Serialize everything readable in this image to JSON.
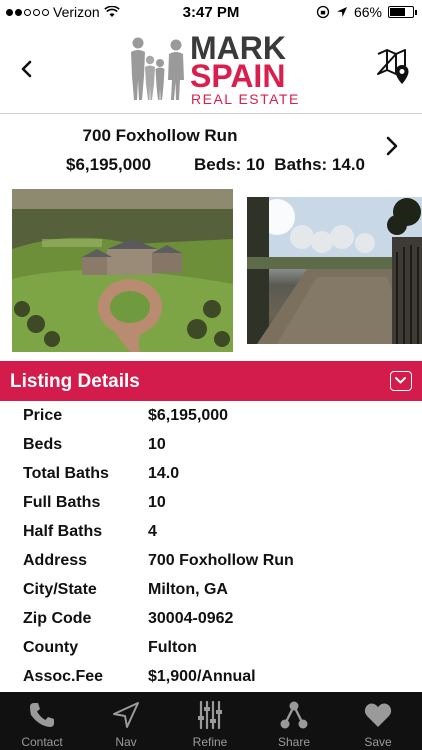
{
  "status_bar": {
    "carrier": "Verizon",
    "time": "3:47 PM",
    "battery": "66%",
    "battery_level": 0.66
  },
  "header": {
    "brand_line1": "MARK",
    "brand_line2": "SPAIN",
    "brand_line3": "REAL ESTATE",
    "back_icon": "chevron-left-icon",
    "map_icon": "map-pin-icon",
    "colors": {
      "brand": "#d31c4b",
      "dark": "#3a3a3a"
    }
  },
  "summary": {
    "address": "700 Foxhollow Run",
    "price": "$6,195,000",
    "beds_baths": "Beds: 10  Baths: 14.0"
  },
  "photos": [
    {
      "name": "aerial-estate-photo"
    },
    {
      "name": "gated-driveway-photo"
    }
  ],
  "details": {
    "title": "Listing Details",
    "rows": [
      {
        "label": "Price",
        "value": "$6,195,000"
      },
      {
        "label": "Beds",
        "value": "10"
      },
      {
        "label": "Total Baths",
        "value": "14.0"
      },
      {
        "label": "Full Baths",
        "value": "10"
      },
      {
        "label": "Half Baths",
        "value": "4"
      },
      {
        "label": "Address",
        "value": "700 Foxhollow Run"
      },
      {
        "label": "City/State",
        "value": "Milton, GA"
      },
      {
        "label": "Zip Code",
        "value": "30004-0962"
      },
      {
        "label": "County",
        "value": "Fulton"
      },
      {
        "label": "Assoc.Fee",
        "value": "$1,900/Annual"
      }
    ]
  },
  "tabs": [
    {
      "label": "Contact",
      "icon": "phone-icon"
    },
    {
      "label": "Nav",
      "icon": "navigation-arrow-icon"
    },
    {
      "label": "Refine",
      "icon": "sliders-icon"
    },
    {
      "label": "Share",
      "icon": "share-icon"
    },
    {
      "label": "Save",
      "icon": "heart-icon"
    }
  ]
}
